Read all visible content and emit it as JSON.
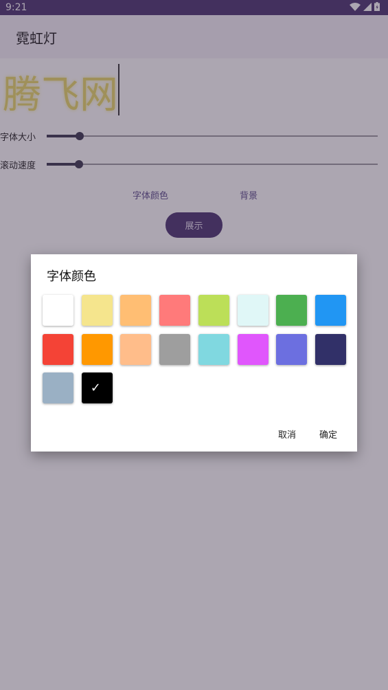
{
  "status": {
    "time": "9:21"
  },
  "appbar": {
    "title": "霓虹灯"
  },
  "display": {
    "text": "腾飞网"
  },
  "controls": {
    "font_size_label": "字体大小",
    "font_size_value": 0.1,
    "speed_label": "滚动速度",
    "speed_value": 0.098,
    "font_color_btn": "字体颜色",
    "background_btn": "背景",
    "show_btn": "展示"
  },
  "dialog": {
    "title": "字体颜色",
    "swatches": [
      {
        "color": "#ffffff",
        "selected": false
      },
      {
        "color": "#f5e58d",
        "selected": false
      },
      {
        "color": "#ffbe73",
        "selected": false
      },
      {
        "color": "#ff7a7a",
        "selected": false
      },
      {
        "color": "#bcdf58",
        "selected": false
      },
      {
        "color": "#e0f7f7",
        "selected": false
      },
      {
        "color": "#4caf50",
        "selected": false
      },
      {
        "color": "#2196f3",
        "selected": false
      },
      {
        "color": "#f44336",
        "selected": false
      },
      {
        "color": "#ff9800",
        "selected": false
      },
      {
        "color": "#ffbd8a",
        "selected": false
      },
      {
        "color": "#9e9e9e",
        "selected": false
      },
      {
        "color": "#80d8e0",
        "selected": false
      },
      {
        "color": "#e056fc",
        "selected": false
      },
      {
        "color": "#6c6fe0",
        "selected": false
      },
      {
        "color": "#313068",
        "selected": false
      },
      {
        "color": "#9ab0c4",
        "selected": false
      },
      {
        "color": "#000000",
        "selected": true
      }
    ],
    "cancel": "取消",
    "confirm": "确定"
  }
}
